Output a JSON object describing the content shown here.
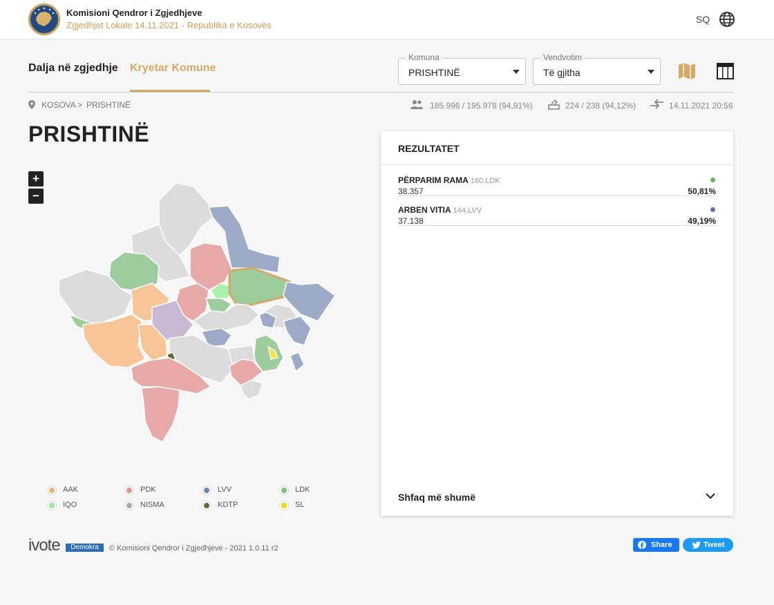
{
  "header": {
    "org_name": "Komisioni Qendror i Zgjedhjeve",
    "subtitle": "Zgjedhjet Lokale 14.11.2021 - Republika e Kosovës",
    "lang": "SQ"
  },
  "tabs": [
    {
      "label": "Dalja në zgjedhje",
      "active": false
    },
    {
      "label": "Kryetar Komune",
      "active": true
    }
  ],
  "filters": {
    "komuna": {
      "legend": "Komuna",
      "value": "PRISHTINË"
    },
    "vendvotim": {
      "legend": "Vendvotim",
      "value": "Të gjitha"
    }
  },
  "breadcrumb": {
    "root": "KOSOVA",
    "separator": ">",
    "current": "PRISHTINË"
  },
  "stats": {
    "voters": "185.996 / 195.978 (94,91%)",
    "stations": "224 / 238 (94,12%)",
    "updated": "14.11.2021 20:56"
  },
  "page_title": "PRISHTINË",
  "zoom": {
    "in": "+",
    "out": "−"
  },
  "legend": [
    {
      "label": "AAK",
      "color": "#f4b27a"
    },
    {
      "label": "PDK",
      "color": "#e28f8f"
    },
    {
      "label": "LVV",
      "color": "#6f85ad"
    },
    {
      "label": "LDK",
      "color": "#7fbf7f"
    },
    {
      "label": "IQO",
      "color": "#90ee90"
    },
    {
      "label": "NISMA",
      "color": "#b89ec0"
    },
    {
      "label": "KDTP",
      "color": "#5e6e3a"
    },
    {
      "label": "SL",
      "color": "#f0d800"
    }
  ],
  "results": {
    "title": "REZULTATET",
    "candidates": [
      {
        "name": "PËRPARIM RAMA",
        "code": "160.LDK",
        "votes": "38.357",
        "percent": "50,81%",
        "share": 0.5081,
        "color": "#5cb85c"
      },
      {
        "name": "ARBEN VITIA",
        "code": "144.LVV",
        "votes": "37.138",
        "percent": "49,19%",
        "share": 0.4919,
        "color": "#5a73a8"
      }
    ],
    "show_more": "Shfaq më shumë"
  },
  "footer": {
    "brand": "ivote",
    "brand_tag": "Demokra",
    "copyright": "© Komisioni Qendror i Zgjedhjeve - 2021 1.0.11 r2",
    "share_label": "Share",
    "tweet_label": "Tweet"
  }
}
